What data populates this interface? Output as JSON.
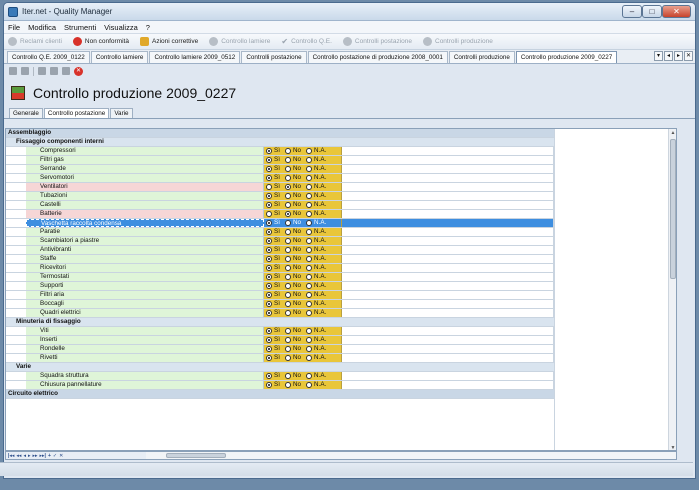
{
  "window": {
    "title": "Iter.net - Quality Manager"
  },
  "menu": [
    "File",
    "Modifica",
    "Strumenti",
    "Visualizza",
    "?"
  ],
  "toolbar": [
    {
      "label": "Reclami clienti",
      "icon": "gray-circle-icon",
      "enabled": false
    },
    {
      "label": "Non conformità",
      "icon": "red-circle-icon",
      "enabled": true
    },
    {
      "label": "Azioni correttive",
      "icon": "warning-icon",
      "enabled": true
    },
    {
      "label": "Controllo lamiere",
      "icon": "pen-icon",
      "enabled": false
    },
    {
      "label": "Controllo Q.E.",
      "icon": "check-icon",
      "enabled": false
    },
    {
      "label": "Controlli postazione",
      "icon": "gear-icon",
      "enabled": false
    },
    {
      "label": "Controlli produzione",
      "icon": "tools-icon",
      "enabled": false
    }
  ],
  "doc_tabs": [
    "Controllo Q.E. 2009_0122",
    "Controllo lamiere",
    "Controllo lamiere 2009_0512",
    "Controlli postazione",
    "Controllo postazione di produzione 2008_0001",
    "Controlli produzione",
    "Controllo produzione 2009_0227"
  ],
  "active_doc_tab": 6,
  "page_title": "Controllo produzione 2009_0227",
  "sub_tabs": [
    "Generale",
    "Controllo postazione",
    "Varie"
  ],
  "active_sub_tab": 1,
  "options": [
    "Sì",
    "No",
    "N.A."
  ],
  "checklist": [
    {
      "type": "group",
      "label": "Assemblaggio"
    },
    {
      "type": "subgroup",
      "label": "Fissaggio componenti interni"
    },
    {
      "type": "item",
      "label": "Compressori",
      "value": "Sì"
    },
    {
      "type": "item",
      "label": "Filtri gas",
      "value": "Sì"
    },
    {
      "type": "item",
      "label": "Serrande",
      "value": "Sì"
    },
    {
      "type": "item",
      "label": "Servomotori",
      "value": "Sì"
    },
    {
      "type": "item",
      "label": "Ventilatori",
      "value": "No",
      "flag": true
    },
    {
      "type": "item",
      "label": "Tubazioni",
      "value": "Sì"
    },
    {
      "type": "item",
      "label": "Castelli",
      "value": "Sì"
    },
    {
      "type": "item",
      "label": "Batterie",
      "value": "No",
      "flag": true
    },
    {
      "type": "item",
      "label": "Vaschetta raccolta condensa",
      "value": "Sì",
      "selected": true
    },
    {
      "type": "item",
      "label": "Paratie",
      "value": "Sì"
    },
    {
      "type": "item",
      "label": "Scambiatori a piastre",
      "value": "Sì"
    },
    {
      "type": "item",
      "label": "Antivibranti",
      "value": "Sì"
    },
    {
      "type": "item",
      "label": "Staffe",
      "value": "Sì"
    },
    {
      "type": "item",
      "label": "Ricevitori",
      "value": "Sì"
    },
    {
      "type": "item",
      "label": "Termostati",
      "value": "Sì"
    },
    {
      "type": "item",
      "label": "Supporti",
      "value": "Sì"
    },
    {
      "type": "item",
      "label": "Filtri aria",
      "value": "Sì"
    },
    {
      "type": "item",
      "label": "Boccagli",
      "value": "Sì"
    },
    {
      "type": "item",
      "label": "Quadri elettrici",
      "value": "Sì"
    },
    {
      "type": "subgroup",
      "label": "Minuteria di fissaggio"
    },
    {
      "type": "item",
      "label": "Viti",
      "value": "Sì"
    },
    {
      "type": "item",
      "label": "Inserti",
      "value": "Sì"
    },
    {
      "type": "item",
      "label": "Rondelle",
      "value": "Sì"
    },
    {
      "type": "item",
      "label": "Rivetti",
      "value": "Sì"
    },
    {
      "type": "subgroup",
      "label": "Varie"
    },
    {
      "type": "item",
      "label": "Squadra struttura",
      "value": "Sì"
    },
    {
      "type": "item",
      "label": "Chiusura pannellature",
      "value": "Sì"
    },
    {
      "type": "group",
      "label": "Circuito elettrico"
    }
  ],
  "colors": {
    "ok": "#dff5d8",
    "flag": "#f6d6d6",
    "options": "#e9c63a",
    "selected": "#3d8ee0"
  }
}
